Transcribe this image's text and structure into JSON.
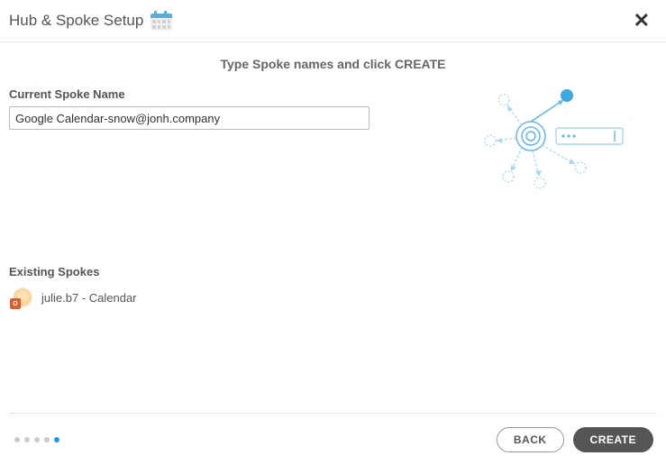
{
  "header": {
    "title": "Hub & Spoke Setup"
  },
  "instruction": "Type Spoke names and click CREATE",
  "form": {
    "currentSpokeLabel": "Current Spoke Name",
    "currentSpokeValue": "Google Calendar-snow@jonh.company"
  },
  "existing": {
    "label": "Existing Spokes",
    "items": [
      {
        "name": "julie.b7 - Calendar"
      }
    ]
  },
  "stepper": {
    "total": 5,
    "active_index": 4
  },
  "buttons": {
    "back": "BACK",
    "create": "CREATE"
  }
}
